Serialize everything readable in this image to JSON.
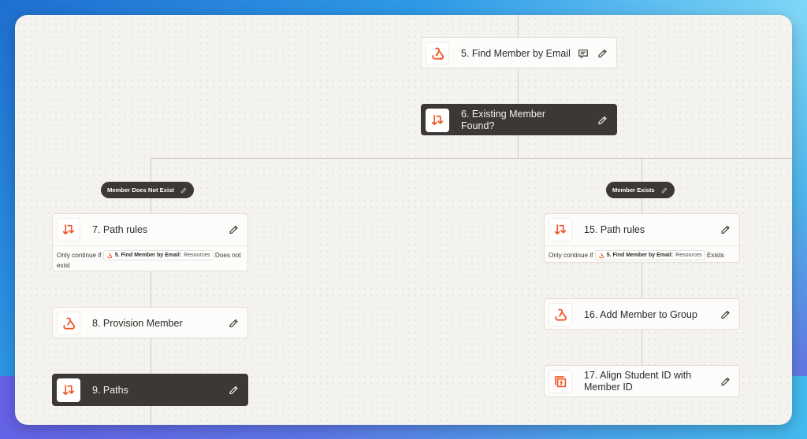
{
  "workflow": {
    "steps": {
      "find_member": {
        "title": "5. Find Member by Email",
        "icon": "webhook-icon"
      },
      "existing_member": {
        "title": "6. Existing Member Found?",
        "icon": "paths-icon"
      },
      "path_rules_7": {
        "title": "7. Path rules",
        "icon": "paths-icon"
      },
      "provision": {
        "title": "8. Provision Member",
        "icon": "webhook-icon"
      },
      "paths_9": {
        "title": "9. Paths",
        "icon": "paths-icon"
      },
      "path_rules_15": {
        "title": "15. Path rules",
        "icon": "paths-icon"
      },
      "add_to_group": {
        "title": "16. Add Member to Group",
        "icon": "webhook-icon"
      },
      "align_id": {
        "title": "17. Align Student ID with Member ID",
        "icon": "formatter-icon"
      }
    },
    "branches": {
      "left": {
        "label": "Member Does Not Exist"
      },
      "right": {
        "label": "Member Exists"
      }
    },
    "rules": {
      "left": {
        "prefix": "Only continue if",
        "step_ref": "5. Find Member by Email:",
        "field": "Resources",
        "condition": "Does not exist"
      },
      "right": {
        "prefix": "Only continue if",
        "step_ref": "5. Find Member by Email:",
        "field": "Resources",
        "condition": "Exists"
      }
    },
    "colors": {
      "accent": "#f0592a",
      "dark_card": "#3b3835",
      "canvas": "#f4f3ef"
    }
  }
}
